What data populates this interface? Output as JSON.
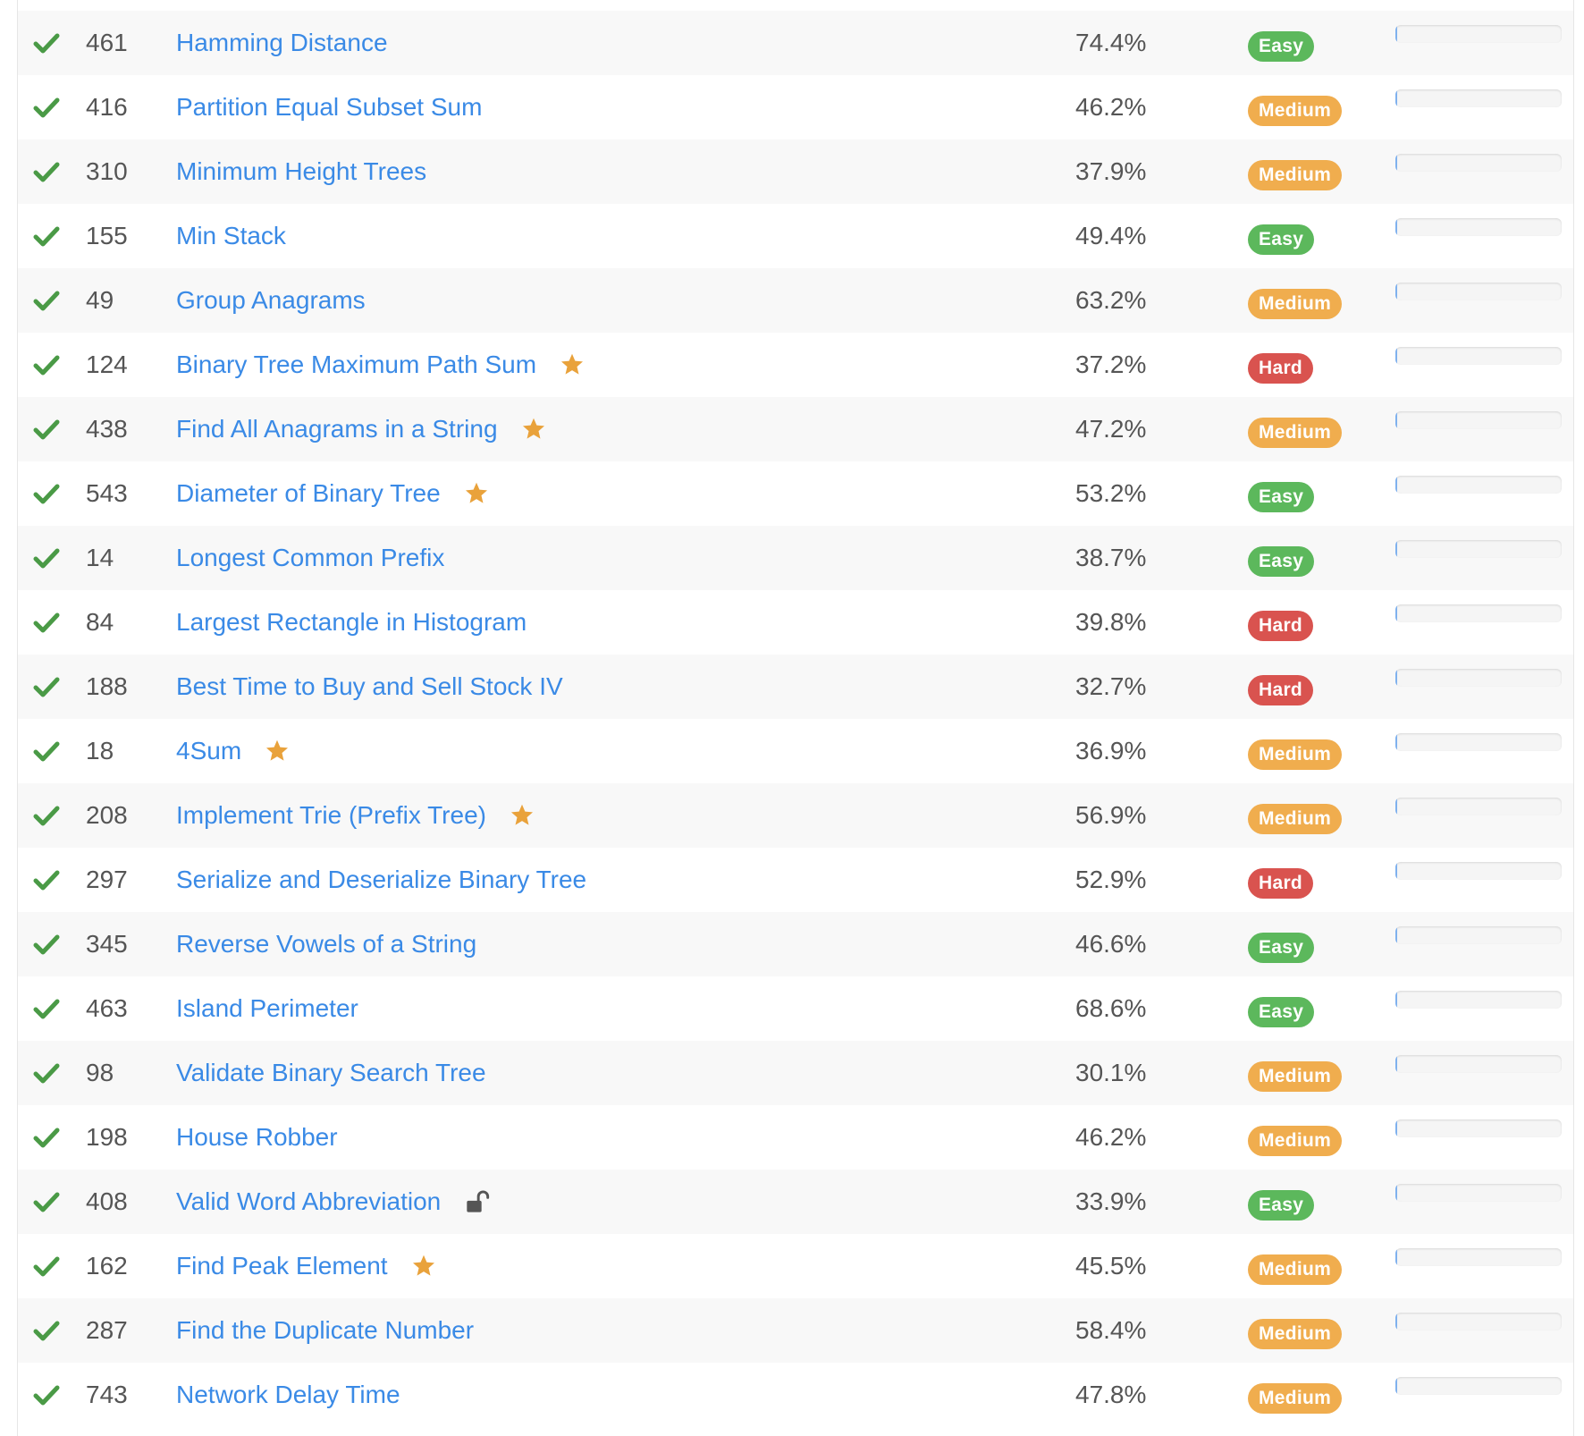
{
  "colors": {
    "link": "#3a8ae6",
    "check": "#4a9a46",
    "star": "#e9a23b",
    "easy": "#5cb85c",
    "medium": "#f0ad4e",
    "hard": "#d9534f"
  },
  "problems": [
    {
      "number": "461",
      "title": "Hamming Distance",
      "acceptance": "74.4%",
      "difficulty": "Easy",
      "starred": false,
      "locked": false,
      "status": "solved",
      "frequency": 0
    },
    {
      "number": "416",
      "title": "Partition Equal Subset Sum",
      "acceptance": "46.2%",
      "difficulty": "Medium",
      "starred": false,
      "locked": false,
      "status": "solved",
      "frequency": 0
    },
    {
      "number": "310",
      "title": "Minimum Height Trees",
      "acceptance": "37.9%",
      "difficulty": "Medium",
      "starred": false,
      "locked": false,
      "status": "solved",
      "frequency": 0
    },
    {
      "number": "155",
      "title": "Min Stack",
      "acceptance": "49.4%",
      "difficulty": "Easy",
      "starred": false,
      "locked": false,
      "status": "solved",
      "frequency": 0
    },
    {
      "number": "49",
      "title": "Group Anagrams",
      "acceptance": "63.2%",
      "difficulty": "Medium",
      "starred": false,
      "locked": false,
      "status": "solved",
      "frequency": 0
    },
    {
      "number": "124",
      "title": "Binary Tree Maximum Path Sum",
      "acceptance": "37.2%",
      "difficulty": "Hard",
      "starred": true,
      "locked": false,
      "status": "solved",
      "frequency": 0
    },
    {
      "number": "438",
      "title": "Find All Anagrams in a String",
      "acceptance": "47.2%",
      "difficulty": "Medium",
      "starred": true,
      "locked": false,
      "status": "solved",
      "frequency": 0
    },
    {
      "number": "543",
      "title": "Diameter of Binary Tree",
      "acceptance": "53.2%",
      "difficulty": "Easy",
      "starred": true,
      "locked": false,
      "status": "solved",
      "frequency": 0
    },
    {
      "number": "14",
      "title": "Longest Common Prefix",
      "acceptance": "38.7%",
      "difficulty": "Easy",
      "starred": false,
      "locked": false,
      "status": "solved",
      "frequency": 0
    },
    {
      "number": "84",
      "title": "Largest Rectangle in Histogram",
      "acceptance": "39.8%",
      "difficulty": "Hard",
      "starred": false,
      "locked": false,
      "status": "solved",
      "frequency": 0
    },
    {
      "number": "188",
      "title": "Best Time to Buy and Sell Stock IV",
      "acceptance": "32.7%",
      "difficulty": "Hard",
      "starred": false,
      "locked": false,
      "status": "solved",
      "frequency": 0
    },
    {
      "number": "18",
      "title": "4Sum",
      "acceptance": "36.9%",
      "difficulty": "Medium",
      "starred": true,
      "locked": false,
      "status": "solved",
      "frequency": 0
    },
    {
      "number": "208",
      "title": "Implement Trie (Prefix Tree)",
      "acceptance": "56.9%",
      "difficulty": "Medium",
      "starred": true,
      "locked": false,
      "status": "solved",
      "frequency": 0
    },
    {
      "number": "297",
      "title": "Serialize and Deserialize Binary Tree",
      "acceptance": "52.9%",
      "difficulty": "Hard",
      "starred": false,
      "locked": false,
      "status": "solved",
      "frequency": 0
    },
    {
      "number": "345",
      "title": "Reverse Vowels of a String",
      "acceptance": "46.6%",
      "difficulty": "Easy",
      "starred": false,
      "locked": false,
      "status": "solved",
      "frequency": 0
    },
    {
      "number": "463",
      "title": "Island Perimeter",
      "acceptance": "68.6%",
      "difficulty": "Easy",
      "starred": false,
      "locked": false,
      "status": "solved",
      "frequency": 0
    },
    {
      "number": "98",
      "title": "Validate Binary Search Tree",
      "acceptance": "30.1%",
      "difficulty": "Medium",
      "starred": false,
      "locked": false,
      "status": "solved",
      "frequency": 0
    },
    {
      "number": "198",
      "title": "House Robber",
      "acceptance": "46.2%",
      "difficulty": "Medium",
      "starred": false,
      "locked": false,
      "status": "solved",
      "frequency": 0
    },
    {
      "number": "408",
      "title": "Valid Word Abbreviation",
      "acceptance": "33.9%",
      "difficulty": "Easy",
      "starred": false,
      "locked": true,
      "status": "solved",
      "frequency": 0
    },
    {
      "number": "162",
      "title": "Find Peak Element",
      "acceptance": "45.5%",
      "difficulty": "Medium",
      "starred": true,
      "locked": false,
      "status": "solved",
      "frequency": 0
    },
    {
      "number": "287",
      "title": "Find the Duplicate Number",
      "acceptance": "58.4%",
      "difficulty": "Medium",
      "starred": false,
      "locked": false,
      "status": "solved",
      "frequency": 0
    },
    {
      "number": "743",
      "title": "Network Delay Time",
      "acceptance": "47.8%",
      "difficulty": "Medium",
      "starred": false,
      "locked": false,
      "status": "solved",
      "frequency": 0
    }
  ]
}
